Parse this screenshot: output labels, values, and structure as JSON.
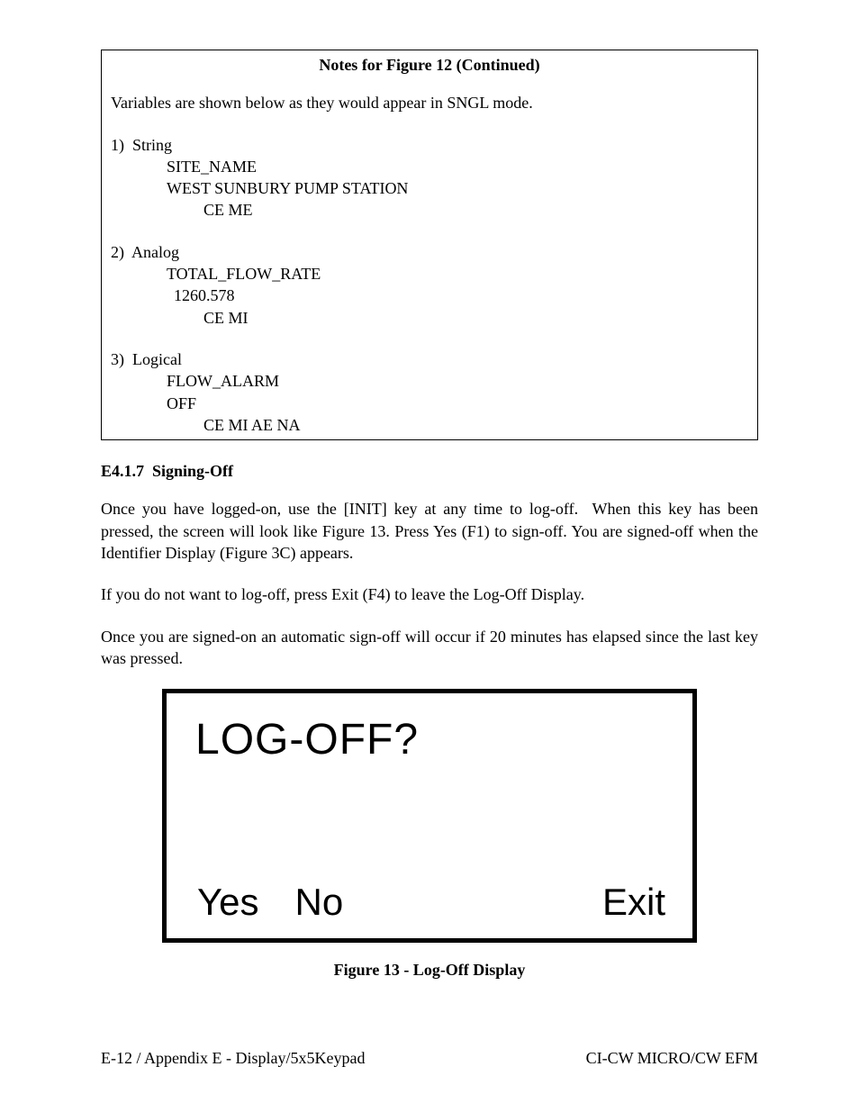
{
  "notes": {
    "title": "Notes for Figure 12 (Continued)",
    "intro": "Variables are shown below as they would appear in SNGL mode.",
    "items": [
      {
        "num": "1)",
        "type": "String",
        "name": "SITE_NAME",
        "value": "WEST SUNBURY PUMP STATION",
        "flags": "CE ME"
      },
      {
        "num": "2)",
        "type": "Analog",
        "name": "TOTAL_FLOW_RATE",
        "value": "1260.578",
        "flags": "CE MI"
      },
      {
        "num": "3)",
        "type": "Logical",
        "name": "FLOW_ALARM",
        "value": "OFF",
        "flags": "CE MI AE NA"
      }
    ]
  },
  "section": {
    "heading": "E4.1.7  Signing-Off",
    "para1": "Once you have logged-on, use the [INIT] key at any time to log-off.  When this key has been pressed, the screen will look like Figure 13. Press Yes (F1) to sign-off. You are signed-off when the Identifier Display (Figure 3C) appears.",
    "para2": "If you do not want to log-off, press Exit (F4) to leave the Log-Off Display.",
    "para3": "Once you are signed-on an automatic sign-off will occur if 20 minutes has elapsed since the last key was pressed."
  },
  "display": {
    "prompt": "LOG-OFF?",
    "yes": "Yes",
    "no": "No",
    "exit": "Exit"
  },
  "figure_caption": "Figure 13 - Log-Off Display",
  "footer": {
    "left": "E-12 / Appendix E - Display/5x5Keypad",
    "right": "CI-CW MICRO/CW EFM"
  }
}
